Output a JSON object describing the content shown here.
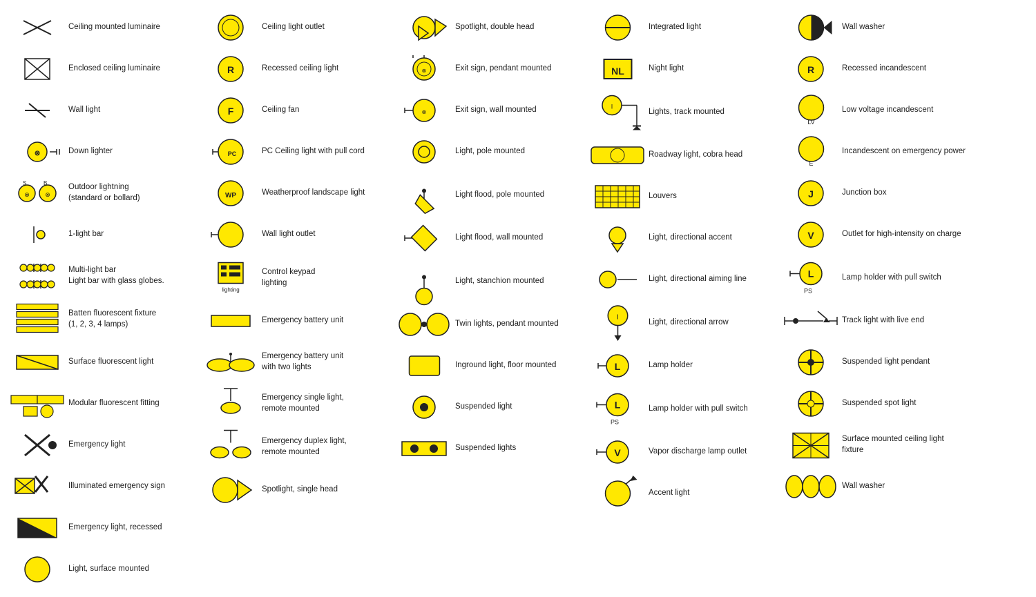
{
  "items": [
    {
      "col": 0,
      "label": "Ceiling mounted luminaire",
      "icon": "ceiling-mounted-luminaire"
    },
    {
      "col": 0,
      "label": "Enclosed ceiling luminaire",
      "icon": "enclosed-ceiling-luminaire"
    },
    {
      "col": 0,
      "label": "Wall light",
      "icon": "wall-light"
    },
    {
      "col": 0,
      "label": "Down lighter",
      "icon": "down-lighter"
    },
    {
      "col": 0,
      "label": "Outdoor lightning\n(standard or bollard)",
      "icon": "outdoor-lightning"
    },
    {
      "col": 0,
      "label": "1-light bar",
      "icon": "one-light-bar"
    },
    {
      "col": 0,
      "label": "Multi-light bar\nLight bar with glass globes.",
      "icon": "multi-light-bar"
    },
    {
      "col": 0,
      "label": "Batten fluorescent fixture\n(1, 2, 3, 4 lamps)",
      "icon": "batten-fluorescent"
    },
    {
      "col": 0,
      "label": "Surface fluorescent light",
      "icon": "surface-fluorescent"
    },
    {
      "col": 0,
      "label": "Modular fluorescent fitting",
      "icon": "modular-fluorescent"
    },
    {
      "col": 0,
      "label": "Emergency light",
      "icon": "emergency-light"
    },
    {
      "col": 0,
      "label": "Illuminated emergency sign",
      "icon": "illuminated-emergency-sign"
    },
    {
      "col": 0,
      "label": "Emergency light, recessed",
      "icon": "emergency-light-recessed"
    },
    {
      "col": 0,
      "label": "Light, surface mounted",
      "icon": "light-surface-mounted"
    },
    {
      "col": 1,
      "label": "Ceiling light outlet",
      "icon": "ceiling-light-outlet"
    },
    {
      "col": 1,
      "label": "Recessed ceiling light",
      "icon": "recessed-ceiling-light"
    },
    {
      "col": 1,
      "label": "Ceiling fan",
      "icon": "ceiling-fan"
    },
    {
      "col": 1,
      "label": "PC Ceiling light with pull cord",
      "icon": "pc-ceiling-pull"
    },
    {
      "col": 1,
      "label": "Weatherproof landscape light",
      "icon": "weatherproof-landscape"
    },
    {
      "col": 1,
      "label": "Wall light outlet",
      "icon": "wall-light-outlet"
    },
    {
      "col": 1,
      "label": "Control keypad\nlighting",
      "icon": "control-keypad"
    },
    {
      "col": 1,
      "label": "Emergency battery unit",
      "icon": "emergency-battery"
    },
    {
      "col": 1,
      "label": "Emergency battery unit\nwith two lights",
      "icon": "emergency-battery-two"
    },
    {
      "col": 1,
      "label": "Emergency single light,\nremote mounted",
      "icon": "emergency-single-remote"
    },
    {
      "col": 1,
      "label": "Emergency duplex light,\nremote mounted",
      "icon": "emergency-duplex-remote"
    },
    {
      "col": 1,
      "label": "Spotlight, single head",
      "icon": "spotlight-single"
    },
    {
      "col": 2,
      "label": "Spotlight, double head",
      "icon": "spotlight-double"
    },
    {
      "col": 2,
      "label": "Exit sign, pendant mounted",
      "icon": "exit-sign-pendant"
    },
    {
      "col": 2,
      "label": "Exit sign, wall mounted",
      "icon": "exit-sign-wall"
    },
    {
      "col": 2,
      "label": "Light, pole mounted",
      "icon": "light-pole-mounted"
    },
    {
      "col": 2,
      "label": "Light flood, pole mounted",
      "icon": "light-flood-pole"
    },
    {
      "col": 2,
      "label": "Light flood, wall mounted",
      "icon": "light-flood-wall"
    },
    {
      "col": 2,
      "label": "Light, stanchion mounted",
      "icon": "light-stanchion"
    },
    {
      "col": 2,
      "label": "Twin lights, pendant mounted",
      "icon": "twin-lights-pendant"
    },
    {
      "col": 2,
      "label": "Inground light, floor mounted",
      "icon": "inground-light"
    },
    {
      "col": 2,
      "label": "Suspended light",
      "icon": "suspended-light"
    },
    {
      "col": 2,
      "label": "Suspended lights",
      "icon": "suspended-lights"
    },
    {
      "col": 3,
      "label": "Integrated light",
      "icon": "integrated-light"
    },
    {
      "col": 3,
      "label": "Night light",
      "icon": "night-light"
    },
    {
      "col": 3,
      "label": "Lights, track mounted",
      "icon": "lights-track-mounted"
    },
    {
      "col": 3,
      "label": "Roadway light, cobra head",
      "icon": "roadway-cobra"
    },
    {
      "col": 3,
      "label": "Louvers",
      "icon": "louvers"
    },
    {
      "col": 3,
      "label": "Light, directional accent",
      "icon": "light-directional-accent"
    },
    {
      "col": 3,
      "label": "Light, directional aiming line",
      "icon": "light-directional-aiming"
    },
    {
      "col": 3,
      "label": "Light, directional arrow",
      "icon": "light-directional-arrow"
    },
    {
      "col": 3,
      "label": "Lamp holder",
      "icon": "lamp-holder"
    },
    {
      "col": 3,
      "label": "Lamp holder with pull switch",
      "icon": "lamp-holder-pull"
    },
    {
      "col": 3,
      "label": "Vapor discharge lamp outlet",
      "icon": "vapor-discharge"
    },
    {
      "col": 3,
      "label": "Accent light",
      "icon": "accent-light"
    },
    {
      "col": 4,
      "label": "Wall washer",
      "icon": "wall-washer-half"
    },
    {
      "col": 4,
      "label": "Recessed incandescent",
      "icon": "recessed-incandescent"
    },
    {
      "col": 4,
      "label": "Low voltage incandescent",
      "icon": "low-voltage-incandescent"
    },
    {
      "col": 4,
      "label": "Incandescent on emergency power",
      "icon": "incandescent-emergency"
    },
    {
      "col": 4,
      "label": "Junction box",
      "icon": "junction-box"
    },
    {
      "col": 4,
      "label": "Outlet for high-intensity on charge",
      "icon": "outlet-high-intensity"
    },
    {
      "col": 4,
      "label": "Lamp holder with pull switch",
      "icon": "lamp-holder-pull2"
    },
    {
      "col": 4,
      "label": "Track light with live end",
      "icon": "track-light-live"
    },
    {
      "col": 4,
      "label": "Suspended light pendant",
      "icon": "suspended-light-pendant"
    },
    {
      "col": 4,
      "label": "Suspended spot light",
      "icon": "suspended-spot-light"
    },
    {
      "col": 4,
      "label": "Surface mounted ceiling light fixture",
      "icon": "surface-mounted-ceiling"
    },
    {
      "col": 4,
      "label": "Wall washer",
      "icon": "wall-washer-ovals"
    }
  ]
}
